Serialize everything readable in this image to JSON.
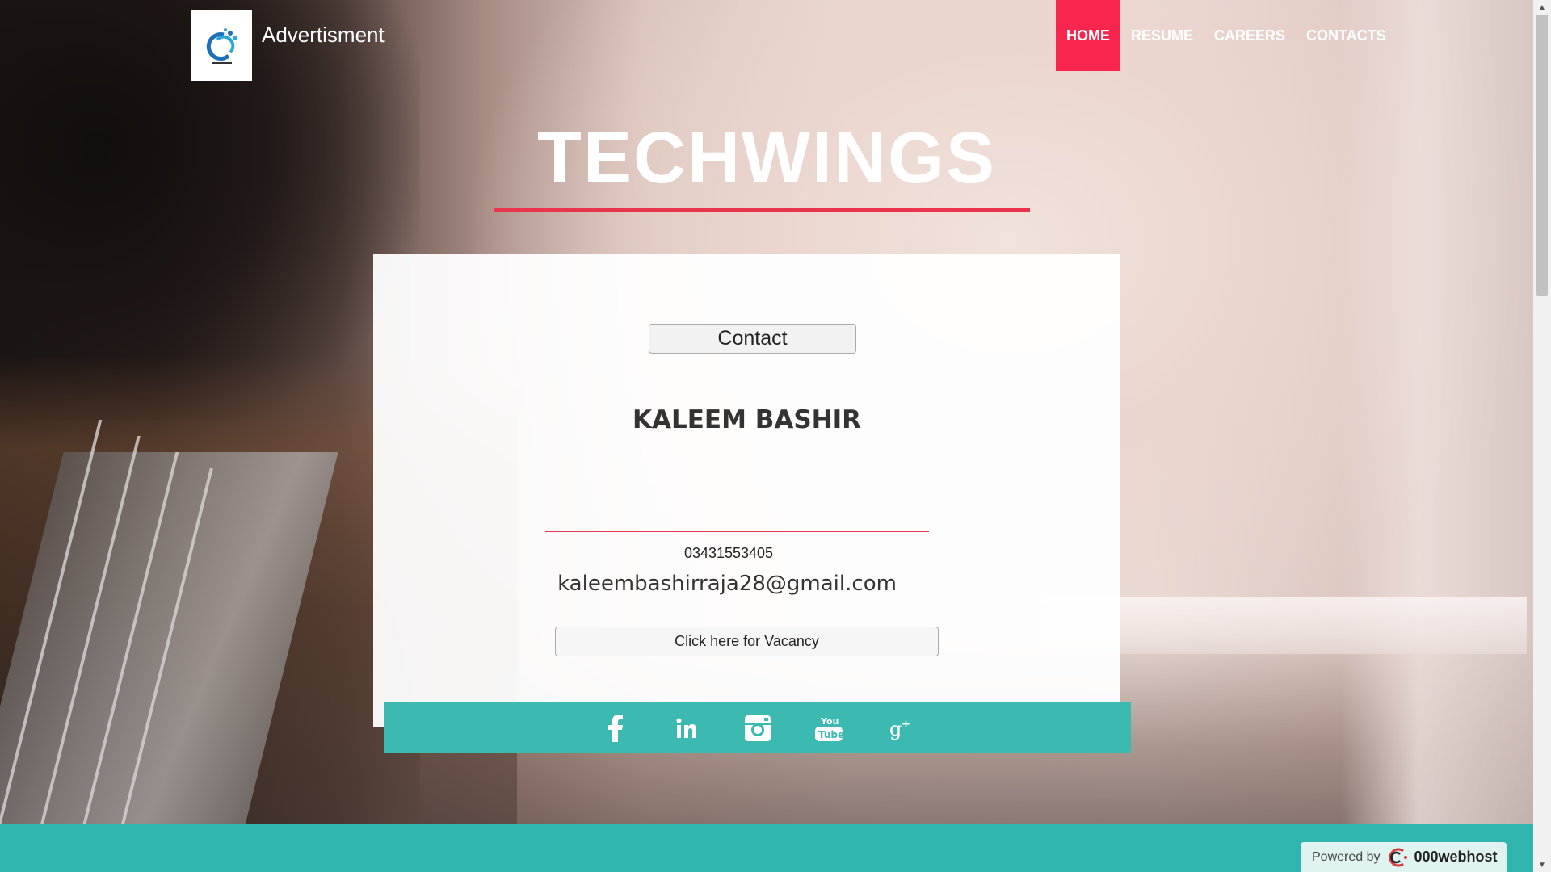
{
  "header": {
    "brand": "Advertisment",
    "nav": [
      {
        "label": "HOME",
        "active": true
      },
      {
        "label": "RESUME",
        "active": false
      },
      {
        "label": "CAREERS",
        "active": false
      },
      {
        "label": "CONTACTS",
        "active": false
      }
    ]
  },
  "hero": {
    "title": "TECHWINGS"
  },
  "card": {
    "contact_button": "Contact",
    "name": "KALEEM BASHIR",
    "phone": "03431553405",
    "email": "kaleembashirraja28@gmail.com",
    "vacancy_button": "Click here for Vacancy"
  },
  "social": [
    {
      "icon": "facebook-icon"
    },
    {
      "icon": "linkedin-icon"
    },
    {
      "icon": "instagram-icon"
    },
    {
      "icon": "youtube-icon"
    },
    {
      "icon": "google-plus-icon"
    }
  ],
  "footer": {
    "powered_prefix": "Powered by",
    "powered_brand": "000webhost"
  },
  "colors": {
    "accent_red": "#f8264f",
    "teal": "#3cb9b0",
    "footer_teal": "#2fb5ad"
  }
}
